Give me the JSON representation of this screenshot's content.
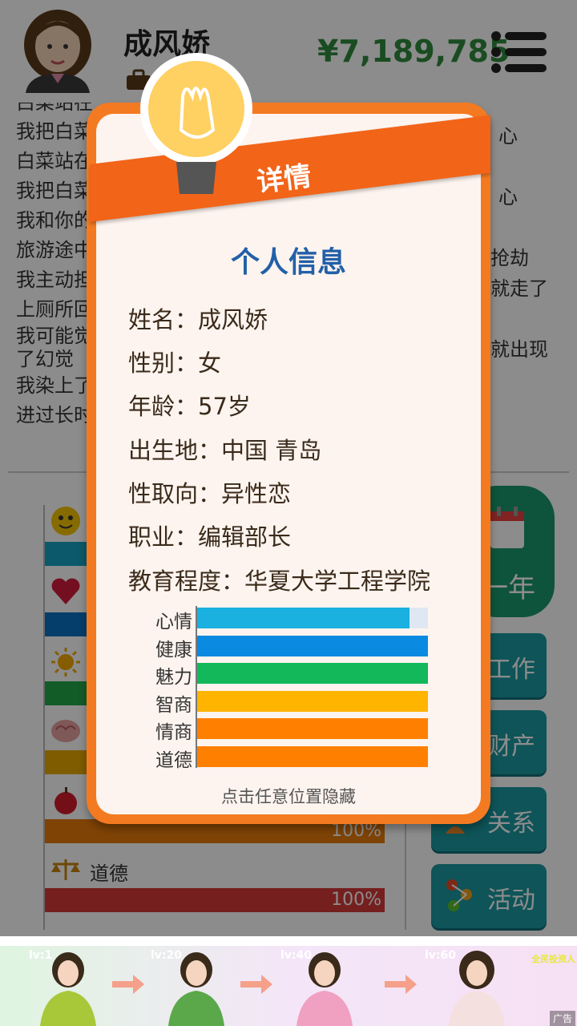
{
  "header": {
    "name": "成风娇",
    "money": "¥7,189,785"
  },
  "log_lines": [
    "白菜站在",
    "我把白菜",
    "白菜站在",
    "我把白菜",
    "我和你的",
    "旅游途中",
    "我主动担",
    "上厕所回",
    "我可能觉",
    "了幻觉",
    "我染上了",
    "进过长时"
  ],
  "log_right": [
    "心",
    "心",
    "抢劫",
    "就走了",
    "就出现"
  ],
  "stats": [
    {
      "label": "",
      "pct": "",
      "color": "#17a2c4"
    },
    {
      "label": "",
      "pct": "",
      "color": "#0a72c4"
    },
    {
      "label": "",
      "pct": "",
      "color": "#22a84a"
    },
    {
      "label": "",
      "pct": "",
      "color": "#e8a800"
    },
    {
      "label": "",
      "pct": "100%",
      "color": "#e87b0a"
    },
    {
      "label": "道德",
      "pct": "100%",
      "color": "#d63a3a"
    }
  ],
  "side_buttons": {
    "next_year": "一年",
    "work": "工作",
    "assets": "财产",
    "relations": "关系",
    "activities": "活动"
  },
  "modal": {
    "ribbon_title": "详情",
    "section_title": "个人信息",
    "info": {
      "name": "姓名：成风娇",
      "gender": "性别：女",
      "age": "年龄：57岁",
      "birthplace": "出生地：中国 青岛",
      "orientation": "性取向：异性恋",
      "job": "职业：编辑部长",
      "education": "教育程度：华夏大学工程学院"
    },
    "bars": [
      {
        "label": "心情",
        "value": 0.92,
        "color": "#1ab0e0"
      },
      {
        "label": "健康",
        "value": 1.0,
        "color": "#0a8ae0"
      },
      {
        "label": "魅力",
        "value": 1.0,
        "color": "#12b85a"
      },
      {
        "label": "智商",
        "value": 1.0,
        "color": "#ffb400"
      },
      {
        "label": "情商",
        "value": 1.0,
        "color": "#ff8000"
      },
      {
        "label": "道德",
        "value": 1.0,
        "color": "#ff8000"
      }
    ],
    "hide_hint": "点击任意位置隐藏"
  },
  "ad": {
    "levels": [
      "lv:1",
      "lv:20",
      "lv:40",
      "lv:60"
    ],
    "logo": "全民投资人",
    "badge": "广告"
  }
}
